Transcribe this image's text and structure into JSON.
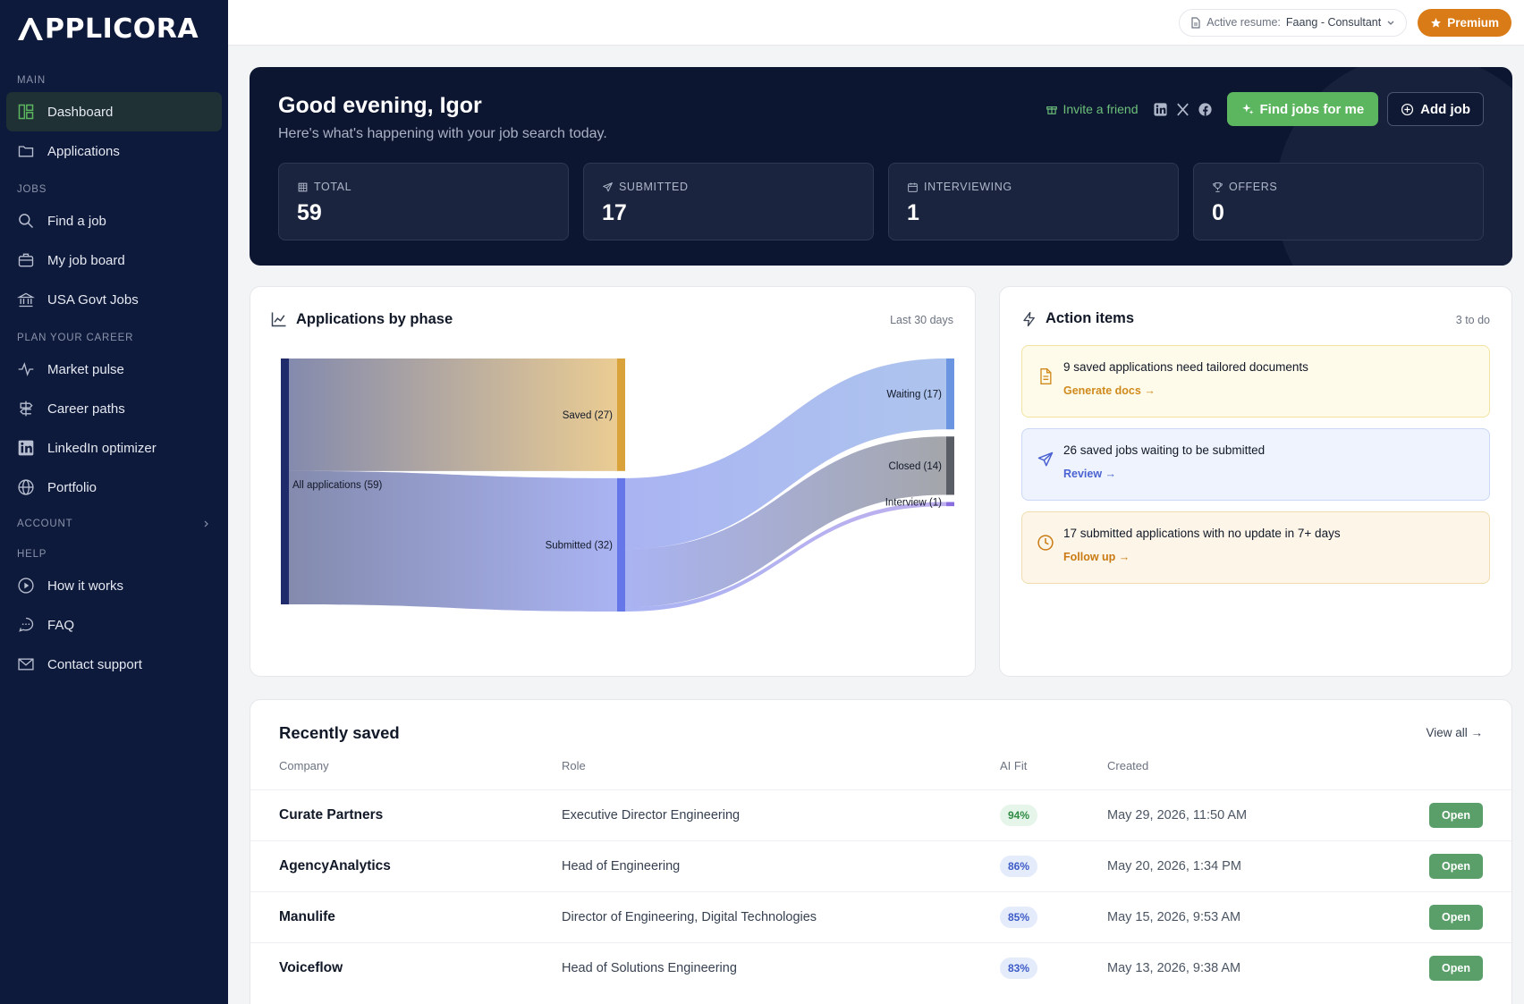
{
  "brand": {
    "logo_text": "PPLICORA"
  },
  "sidebar": {
    "sections": [
      {
        "title": "MAIN",
        "items": [
          {
            "label": "Dashboard",
            "icon": "dashboard-icon",
            "active": true
          },
          {
            "label": "Applications",
            "icon": "folder-icon"
          }
        ]
      },
      {
        "title": "JOBS",
        "items": [
          {
            "label": "Find a job",
            "icon": "search-icon"
          },
          {
            "label": "My job board",
            "icon": "briefcase-icon"
          },
          {
            "label": "USA Govt Jobs",
            "icon": "landmark-icon"
          }
        ]
      },
      {
        "title": "PLAN YOUR CAREER",
        "items": [
          {
            "label": "Market pulse",
            "icon": "pulse-icon"
          },
          {
            "label": "Career paths",
            "icon": "signpost-icon"
          },
          {
            "label": "LinkedIn optimizer",
            "icon": "linkedin-icon"
          },
          {
            "label": "Portfolio",
            "icon": "globe-icon"
          }
        ]
      },
      {
        "title": "ACCOUNT",
        "items": []
      },
      {
        "title": "HELP",
        "items": [
          {
            "label": "How it works",
            "icon": "play-circle-icon"
          },
          {
            "label": "FAQ",
            "icon": "chat-icon"
          },
          {
            "label": "Contact support",
            "icon": "mail-icon"
          }
        ]
      }
    ]
  },
  "topbar": {
    "resume_label": "Active resume:",
    "resume_value": "Faang - Consultant",
    "premium_label": "Premium"
  },
  "hero": {
    "greeting": "Good evening, Igor",
    "subtitle": "Here's what's happening with your job search today.",
    "invite_label": "Invite a friend",
    "find_jobs_label": "Find jobs for me",
    "add_job_label": "Add job",
    "stats": [
      {
        "label": "TOTAL",
        "value": "59",
        "icon": "grid-icon"
      },
      {
        "label": "SUBMITTED",
        "value": "17",
        "icon": "send-icon"
      },
      {
        "label": "INTERVIEWING",
        "value": "1",
        "icon": "calendar-icon"
      },
      {
        "label": "OFFERS",
        "value": "0",
        "icon": "trophy-icon"
      }
    ]
  },
  "phases": {
    "title": "Applications by phase",
    "period": "Last 30 days",
    "chart_data": {
      "type": "sankey",
      "nodes": [
        {
          "name": "All applications",
          "value": 59,
          "color": "#1f2b6b"
        },
        {
          "name": "Saved",
          "value": 27,
          "color": "#d9a23a"
        },
        {
          "name": "Submitted",
          "value": 32,
          "color": "#6476e8"
        },
        {
          "name": "Waiting",
          "value": 17,
          "color": "#6b95e0"
        },
        {
          "name": "Closed",
          "value": 14,
          "color": "#5a5d66"
        },
        {
          "name": "Interview",
          "value": 1,
          "color": "#8a6ee0"
        }
      ],
      "labels": [
        "All applications (59)",
        "Saved (27)",
        "Submitted (32)",
        "Waiting (17)",
        "Closed (14)",
        "Interview (1)"
      ],
      "links": [
        {
          "source": "All applications",
          "target": "Saved",
          "value": 27
        },
        {
          "source": "All applications",
          "target": "Submitted",
          "value": 32
        },
        {
          "source": "Submitted",
          "target": "Waiting",
          "value": 17
        },
        {
          "source": "Submitted",
          "target": "Closed",
          "value": 14
        },
        {
          "source": "Submitted",
          "target": "Interview",
          "value": 1
        }
      ]
    }
  },
  "actions": {
    "title": "Action items",
    "count": "3 to do",
    "items": [
      {
        "text": "9 saved applications need tailored documents",
        "link": "Generate docs →",
        "bg": "#fefbea",
        "border": "#f3e3a3",
        "accent": "#d08a1c"
      },
      {
        "text": "26 saved jobs waiting to be submitted",
        "link": "Review →",
        "bg": "#eef3fd",
        "border": "#cbd8f6",
        "accent": "#4b63d2"
      },
      {
        "text": "17 submitted applications with no update in 7+ days",
        "link": "Follow up →",
        "bg": "#fdf6e8",
        "border": "#f0dcae",
        "accent": "#c97a12"
      }
    ]
  },
  "recent": {
    "title": "Recently saved",
    "view_all": "View all →",
    "columns": [
      "Company",
      "Role",
      "AI Fit",
      "Created"
    ],
    "rows": [
      {
        "company": "Curate Partners",
        "role": "Executive Director Engineering",
        "fit": "94%",
        "created": "May 29, 2026, 11:50 AM",
        "open": "Open",
        "fit_bg": "#e6f5ea",
        "fit_fg": "#2f8a44"
      },
      {
        "company": "AgencyAnalytics",
        "role": "Head of Engineering",
        "fit": "86%",
        "created": "May 20, 2026, 1:34 PM",
        "open": "Open",
        "fit_bg": "#e4ebfb",
        "fit_fg": "#3d5bc7"
      },
      {
        "company": "Manulife",
        "role": "Director of Engineering, Digital Technologies",
        "fit": "85%",
        "created": "May 15, 2026, 9:53 AM",
        "open": "Open",
        "fit_bg": "#e4ebfb",
        "fit_fg": "#3d5bc7"
      },
      {
        "company": "Voiceflow",
        "role": "Head of Solutions Engineering",
        "fit": "83%",
        "created": "May 13, 2026, 9:38 AM",
        "open": "Open",
        "fit_bg": "#e4ebfb",
        "fit_fg": "#3d5bc7"
      }
    ]
  }
}
